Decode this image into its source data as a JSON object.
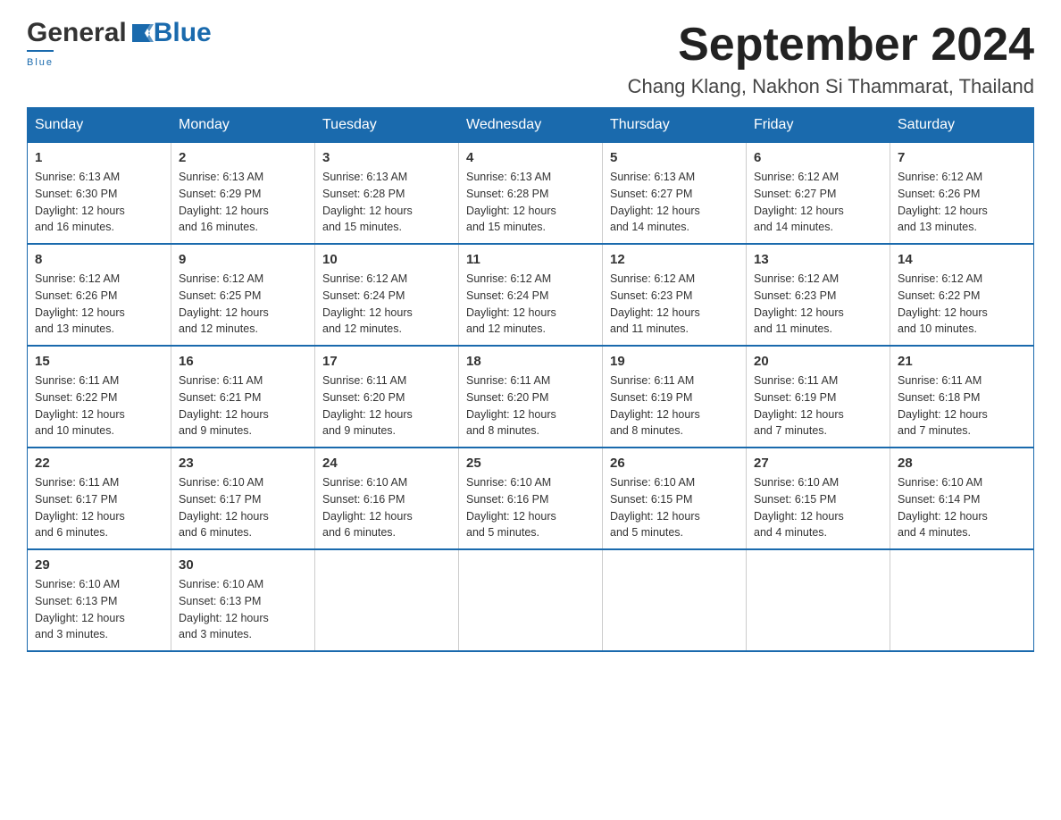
{
  "logo": {
    "general": "General",
    "blue": "Blue",
    "tagline": "Blue"
  },
  "title": {
    "month": "September 2024",
    "location": "Chang Klang, Nakhon Si Thammarat, Thailand"
  },
  "header_colors": {
    "bg": "#1a6aad",
    "text": "#ffffff"
  },
  "weekdays": [
    "Sunday",
    "Monday",
    "Tuesday",
    "Wednesday",
    "Thursday",
    "Friday",
    "Saturday"
  ],
  "weeks": [
    [
      {
        "day": "1",
        "sunrise": "6:13 AM",
        "sunset": "6:30 PM",
        "daylight": "12 hours and 16 minutes."
      },
      {
        "day": "2",
        "sunrise": "6:13 AM",
        "sunset": "6:29 PM",
        "daylight": "12 hours and 16 minutes."
      },
      {
        "day": "3",
        "sunrise": "6:13 AM",
        "sunset": "6:28 PM",
        "daylight": "12 hours and 15 minutes."
      },
      {
        "day": "4",
        "sunrise": "6:13 AM",
        "sunset": "6:28 PM",
        "daylight": "12 hours and 15 minutes."
      },
      {
        "day": "5",
        "sunrise": "6:13 AM",
        "sunset": "6:27 PM",
        "daylight": "12 hours and 14 minutes."
      },
      {
        "day": "6",
        "sunrise": "6:12 AM",
        "sunset": "6:27 PM",
        "daylight": "12 hours and 14 minutes."
      },
      {
        "day": "7",
        "sunrise": "6:12 AM",
        "sunset": "6:26 PM",
        "daylight": "12 hours and 13 minutes."
      }
    ],
    [
      {
        "day": "8",
        "sunrise": "6:12 AM",
        "sunset": "6:26 PM",
        "daylight": "12 hours and 13 minutes."
      },
      {
        "day": "9",
        "sunrise": "6:12 AM",
        "sunset": "6:25 PM",
        "daylight": "12 hours and 12 minutes."
      },
      {
        "day": "10",
        "sunrise": "6:12 AM",
        "sunset": "6:24 PM",
        "daylight": "12 hours and 12 minutes."
      },
      {
        "day": "11",
        "sunrise": "6:12 AM",
        "sunset": "6:24 PM",
        "daylight": "12 hours and 12 minutes."
      },
      {
        "day": "12",
        "sunrise": "6:12 AM",
        "sunset": "6:23 PM",
        "daylight": "12 hours and 11 minutes."
      },
      {
        "day": "13",
        "sunrise": "6:12 AM",
        "sunset": "6:23 PM",
        "daylight": "12 hours and 11 minutes."
      },
      {
        "day": "14",
        "sunrise": "6:12 AM",
        "sunset": "6:22 PM",
        "daylight": "12 hours and 10 minutes."
      }
    ],
    [
      {
        "day": "15",
        "sunrise": "6:11 AM",
        "sunset": "6:22 PM",
        "daylight": "12 hours and 10 minutes."
      },
      {
        "day": "16",
        "sunrise": "6:11 AM",
        "sunset": "6:21 PM",
        "daylight": "12 hours and 9 minutes."
      },
      {
        "day": "17",
        "sunrise": "6:11 AM",
        "sunset": "6:20 PM",
        "daylight": "12 hours and 9 minutes."
      },
      {
        "day": "18",
        "sunrise": "6:11 AM",
        "sunset": "6:20 PM",
        "daylight": "12 hours and 8 minutes."
      },
      {
        "day": "19",
        "sunrise": "6:11 AM",
        "sunset": "6:19 PM",
        "daylight": "12 hours and 8 minutes."
      },
      {
        "day": "20",
        "sunrise": "6:11 AM",
        "sunset": "6:19 PM",
        "daylight": "12 hours and 7 minutes."
      },
      {
        "day": "21",
        "sunrise": "6:11 AM",
        "sunset": "6:18 PM",
        "daylight": "12 hours and 7 minutes."
      }
    ],
    [
      {
        "day": "22",
        "sunrise": "6:11 AM",
        "sunset": "6:17 PM",
        "daylight": "12 hours and 6 minutes."
      },
      {
        "day": "23",
        "sunrise": "6:10 AM",
        "sunset": "6:17 PM",
        "daylight": "12 hours and 6 minutes."
      },
      {
        "day": "24",
        "sunrise": "6:10 AM",
        "sunset": "6:16 PM",
        "daylight": "12 hours and 6 minutes."
      },
      {
        "day": "25",
        "sunrise": "6:10 AM",
        "sunset": "6:16 PM",
        "daylight": "12 hours and 5 minutes."
      },
      {
        "day": "26",
        "sunrise": "6:10 AM",
        "sunset": "6:15 PM",
        "daylight": "12 hours and 5 minutes."
      },
      {
        "day": "27",
        "sunrise": "6:10 AM",
        "sunset": "6:15 PM",
        "daylight": "12 hours and 4 minutes."
      },
      {
        "day": "28",
        "sunrise": "6:10 AM",
        "sunset": "6:14 PM",
        "daylight": "12 hours and 4 minutes."
      }
    ],
    [
      {
        "day": "29",
        "sunrise": "6:10 AM",
        "sunset": "6:13 PM",
        "daylight": "12 hours and 3 minutes."
      },
      {
        "day": "30",
        "sunrise": "6:10 AM",
        "sunset": "6:13 PM",
        "daylight": "12 hours and 3 minutes."
      },
      null,
      null,
      null,
      null,
      null
    ]
  ],
  "labels": {
    "sunrise": "Sunrise:",
    "sunset": "Sunset:",
    "daylight": "Daylight:"
  }
}
